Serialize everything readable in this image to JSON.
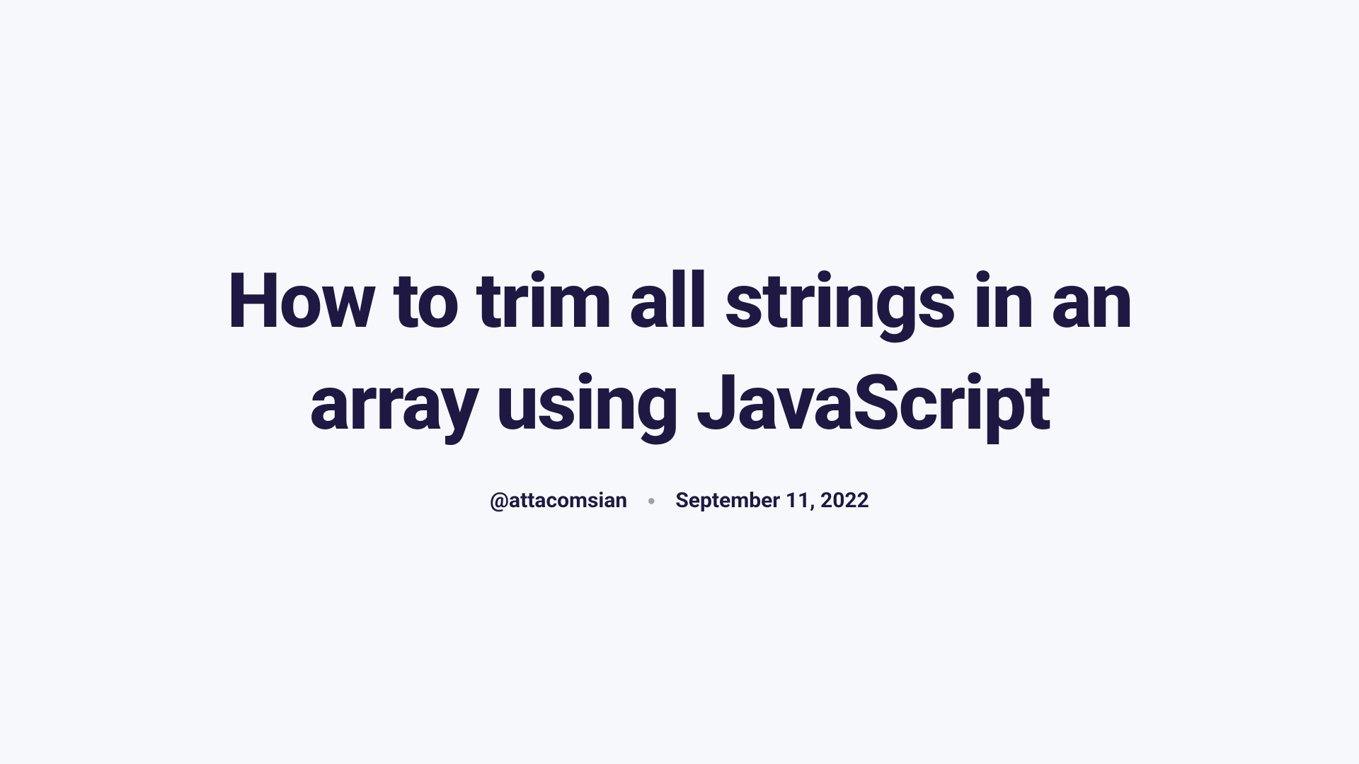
{
  "article": {
    "title": "How to trim all strings in an array using JavaScript",
    "author": "@attacomsian",
    "date": "September 11, 2022"
  }
}
